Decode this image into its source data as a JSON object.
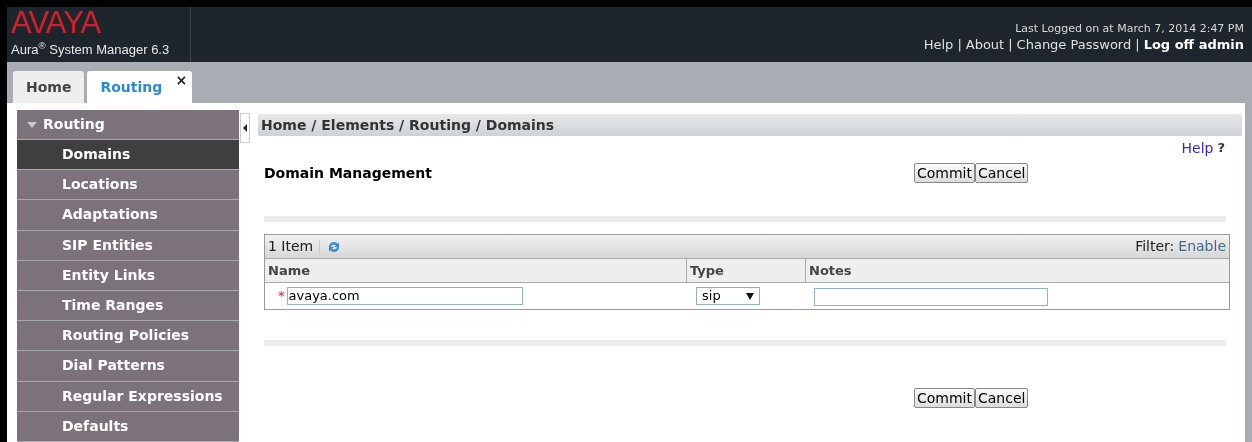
{
  "header": {
    "logo": "AVAYA",
    "product": "Aura",
    "product_mark": "®",
    "product_rest": "System Manager 6.3",
    "last_login": "Last Logged on at March 7, 2014 2:47 PM",
    "links": [
      {
        "label": "Help",
        "bold": false
      },
      {
        "label": "About",
        "bold": false
      },
      {
        "label": "Change Password",
        "bold": false
      },
      {
        "label": "Log off admin",
        "bold": true
      }
    ],
    "separator": "|"
  },
  "tabs": [
    {
      "label": "Home",
      "selected": false,
      "closable": false
    },
    {
      "label": "Routing",
      "selected": true,
      "closable": true,
      "close_glyph": "×"
    }
  ],
  "sidebar": {
    "title": "Routing",
    "expanded": true,
    "items": [
      {
        "label": "Domains",
        "selected": true
      },
      {
        "label": "Locations",
        "selected": false
      },
      {
        "label": "Adaptations",
        "selected": false
      },
      {
        "label": "SIP Entities",
        "selected": false
      },
      {
        "label": "Entity Links",
        "selected": false
      },
      {
        "label": "Time Ranges",
        "selected": false
      },
      {
        "label": "Routing Policies",
        "selected": false
      },
      {
        "label": "Dial Patterns",
        "selected": false
      },
      {
        "label": "Regular Expressions",
        "selected": false
      },
      {
        "label": "Defaults",
        "selected": false
      }
    ]
  },
  "breadcrumb": "Home / Elements / Routing / Domains",
  "help": {
    "label": "Help",
    "mark": "?"
  },
  "title": "Domain Management",
  "top_buttons": [
    "Commit",
    "Cancel"
  ],
  "table": {
    "count": "1 Item",
    "filter_label": "Filter:",
    "filter_link": "Enable",
    "columns": [
      "Name",
      "Type",
      "Notes"
    ],
    "rows": [
      {
        "required_mark": "*",
        "name": "avaya.com",
        "type": "sip",
        "notes": ""
      }
    ]
  },
  "bottom_buttons": [
    "Commit",
    "Cancel"
  ]
}
